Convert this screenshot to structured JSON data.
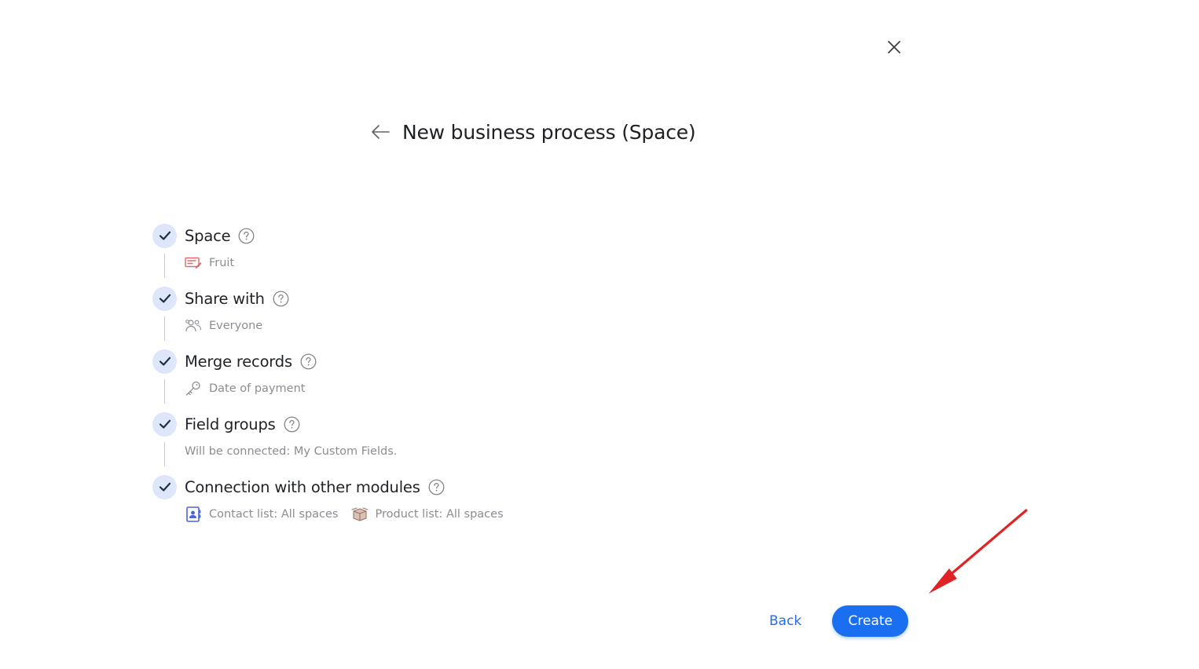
{
  "header": {
    "title": "New business process (Space)"
  },
  "steps": [
    {
      "label": "Space",
      "detail_icon": "record-edit-icon",
      "detail_text": "Fruit"
    },
    {
      "label": "Share with",
      "detail_icon": "users-icon",
      "detail_text": "Everyone"
    },
    {
      "label": "Merge records",
      "detail_icon": "key-icon",
      "detail_text": "Date of payment"
    },
    {
      "label": "Field groups",
      "detail_text": "Will be connected: My Custom Fields."
    },
    {
      "label": "Connection with other modules",
      "modules": [
        {
          "icon": "contact-book-icon",
          "text": "Contact list: All spaces"
        },
        {
          "icon": "product-box-icon",
          "text": "Product list: All spaces"
        }
      ]
    }
  ],
  "footer": {
    "back_label": "Back",
    "create_label": "Create"
  },
  "colors": {
    "accent": "#1a6ef0",
    "link": "#2b6be6",
    "check_bg": "#dde6fb",
    "check_mark": "#1f2a44",
    "space_icon": "#e06a6a",
    "contact_icon": "#4a63e0",
    "product_icon": "#b08a78",
    "annotation_arrow": "#e02424"
  }
}
